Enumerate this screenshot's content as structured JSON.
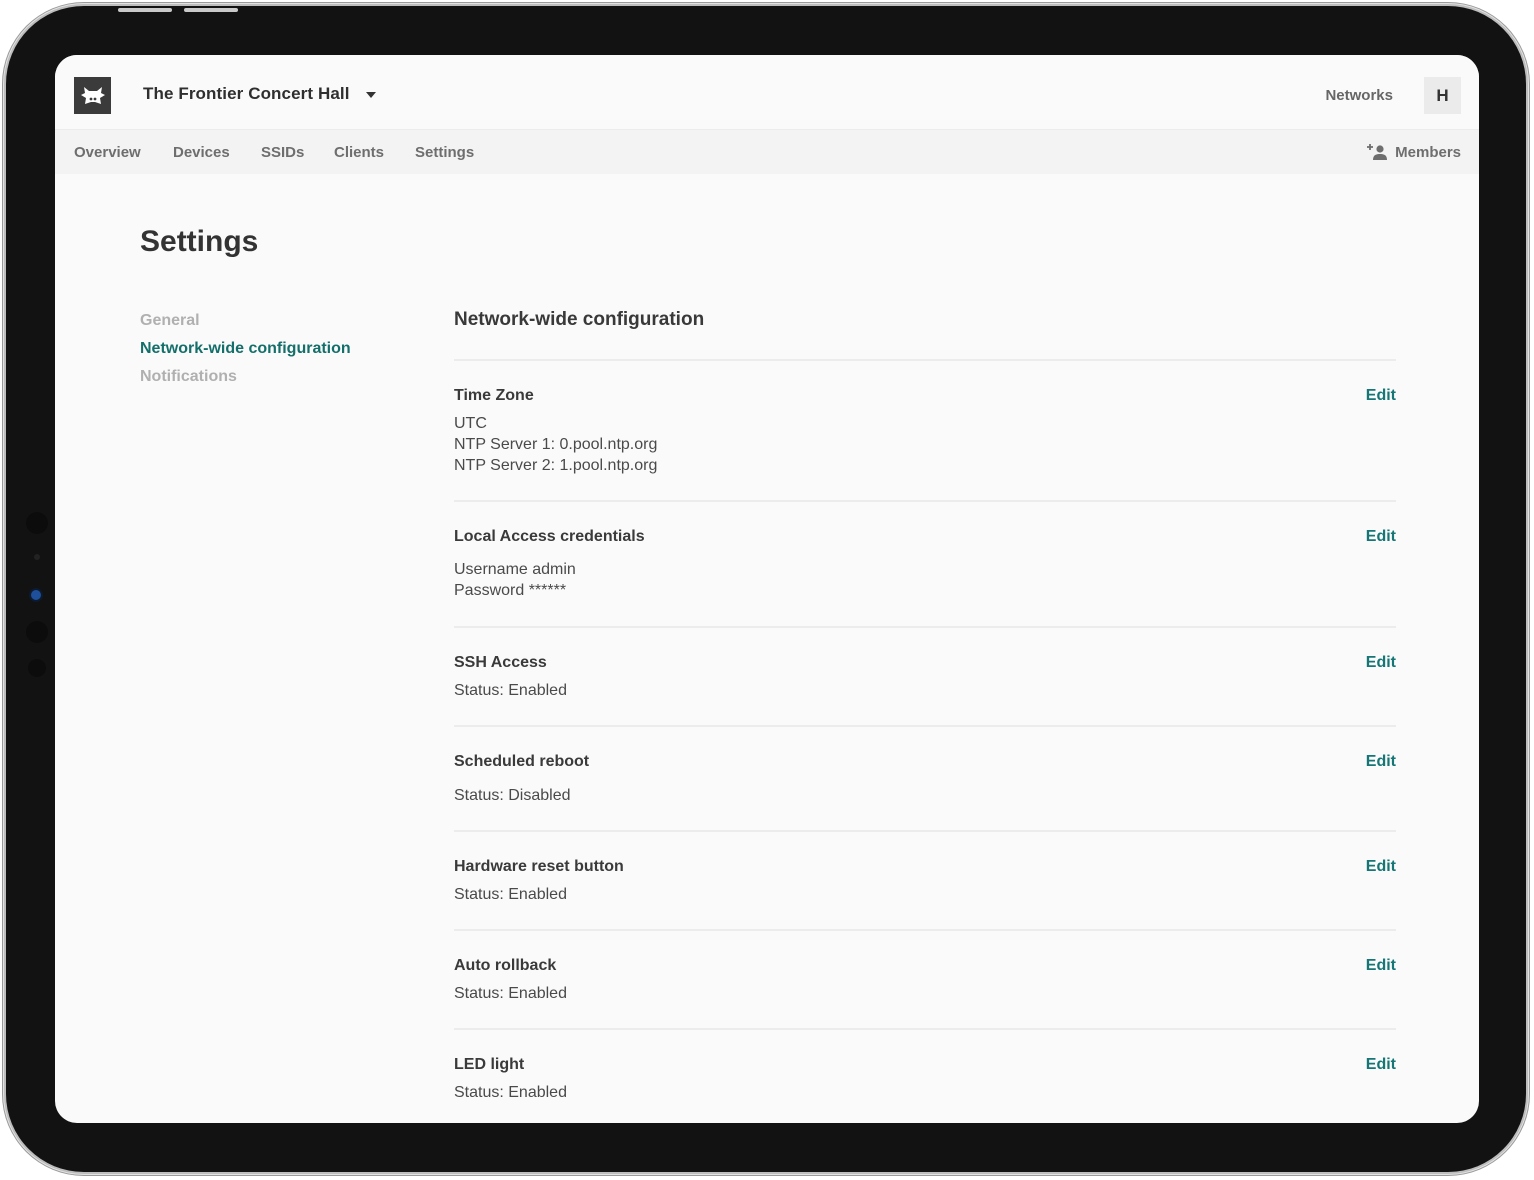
{
  "header": {
    "org_name": "The Frontier Concert Hall",
    "networks_label": "Networks",
    "avatar_initial": "H"
  },
  "subnav": {
    "items": [
      {
        "label": "Overview"
      },
      {
        "label": "Devices"
      },
      {
        "label": "SSIDs"
      },
      {
        "label": "Clients"
      },
      {
        "label": "Settings"
      }
    ],
    "members_label": "Members"
  },
  "page": {
    "title": "Settings"
  },
  "side_menu": {
    "items": [
      {
        "label": "General",
        "active": false
      },
      {
        "label": "Network-wide configuration",
        "active": true
      },
      {
        "label": "Notifications",
        "active": false
      }
    ]
  },
  "section": {
    "title": "Network-wide configuration",
    "edit_label": "Edit",
    "rows": [
      {
        "title": "Time Zone",
        "lines": [
          "UTC",
          "NTP Server 1: 0.pool.ntp.org",
          "NTP Server 2: 1.pool.ntp.org"
        ]
      },
      {
        "title": "Local Access credentials",
        "lines": [
          "Username admin",
          "Password ******"
        ]
      },
      {
        "title": "SSH Access",
        "lines": [
          "Status: Enabled"
        ]
      },
      {
        "title": "Scheduled reboot",
        "lines": [
          "Status: Disabled"
        ]
      },
      {
        "title": "Hardware reset button",
        "lines": [
          "Status: Enabled"
        ]
      },
      {
        "title": "Auto rollback",
        "lines": [
          "Status: Enabled"
        ]
      },
      {
        "title": "LED light",
        "lines": [
          "Status: Enabled"
        ]
      }
    ]
  },
  "colors": {
    "accent": "#146f6b",
    "edit": "#167575",
    "inactive_menu": "#b0b0b0",
    "logo_bg": "#3b3b3b"
  }
}
